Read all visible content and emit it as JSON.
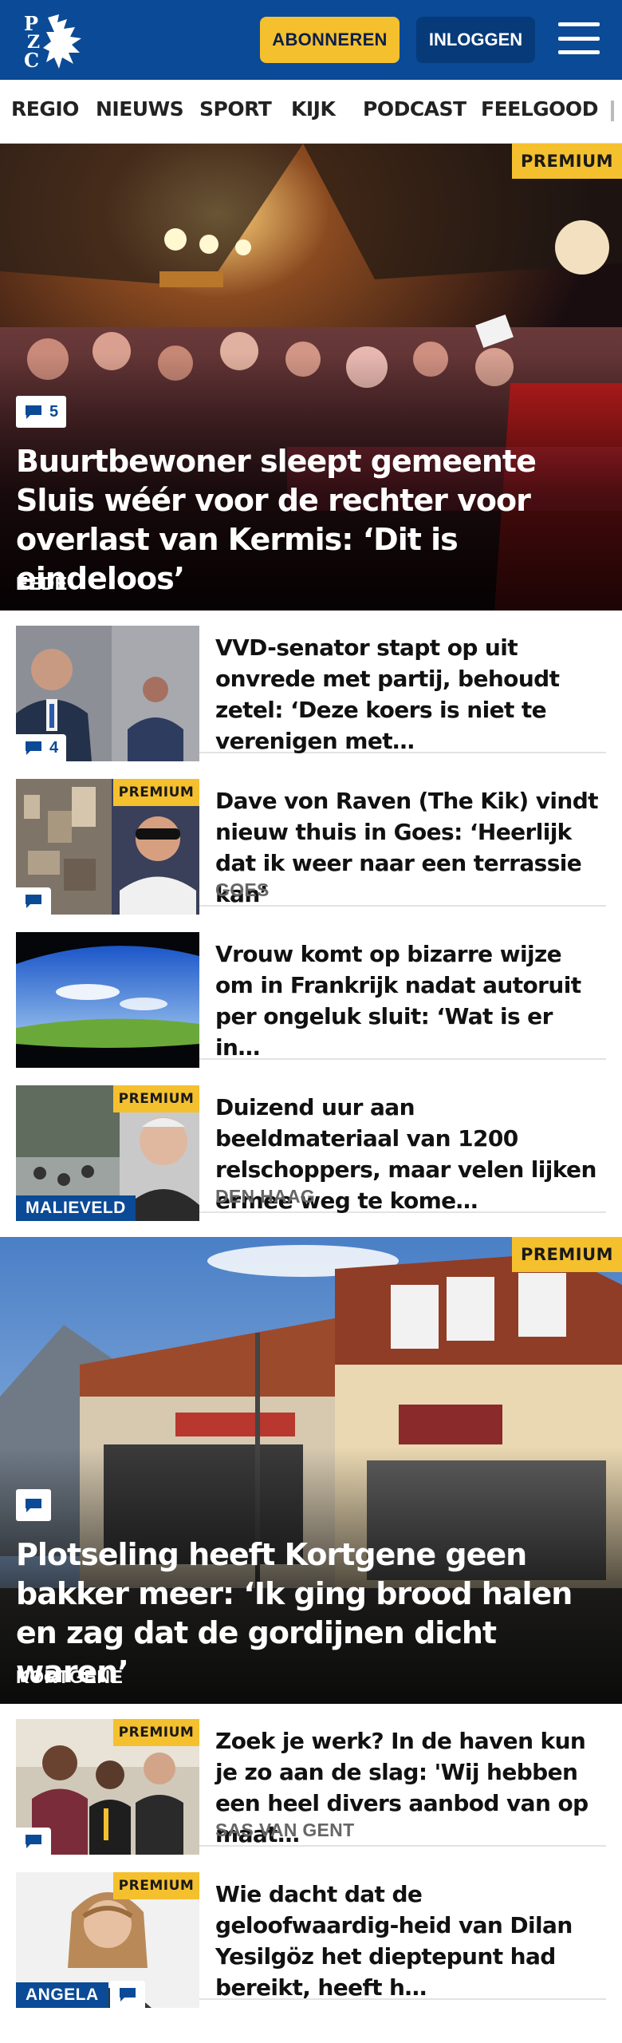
{
  "header": {
    "logo_text": "PZC",
    "subscribe_label": "ABONNEREN",
    "login_label": "INLOGGEN"
  },
  "nav": {
    "items": [
      "REGIO",
      "NIEUWS",
      "SPORT",
      "KIJK",
      "PODCAST",
      "FEELGOOD"
    ]
  },
  "hero1": {
    "badge": "PREMIUM",
    "comments": "5",
    "title": "Buurtbewoner sleept gemeente Sluis wéér voor de rechter voor overlast van Kermis: ‘Dit is eindeloos’",
    "location": "EEDE"
  },
  "items1": [
    {
      "title": "VVD-senator stapt op uit onvrede met partij, behoudt zetel: ‘Deze koers is niet te verenigen met…",
      "comments": "4",
      "location": ""
    },
    {
      "title": "Dave von Raven (The Kik) vindt nieuw thuis in Goes: ‘Heerlijk dat ik weer naar een terrassie kan’",
      "badge": "PREMIUM",
      "location": "GOES"
    },
    {
      "title": "Vrouw komt op bizarre wijze om in Frankrijk nadat autoruit per ongeluk sluit: ‘Wat is er in…",
      "location": ""
    },
    {
      "title": "Duizend uur aan beeldmateriaal van 1200 relschoppers, maar velen lijken ermee weg te kome…",
      "badge": "PREMIUM",
      "tag": "MALIEVELD",
      "location": "DEN HAAG"
    }
  ],
  "hero2": {
    "badge": "PREMIUM",
    "title": "Plotseling heeft Kortgene geen bakker meer: ‘Ik ging brood halen en zag dat de gordijnen dicht waren’",
    "location": "KORTGENE"
  },
  "items2": [
    {
      "title": "Zoek je werk? In de haven kun je zo aan de slag: 'Wij hebben een heel divers aanbod van op maat…",
      "badge": "PREMIUM",
      "location": "SAS VAN GENT"
    },
    {
      "title": "Wie dacht dat de geloofwaardig-heid van Dilan Yesilgöz het dieptepunt had bereikt, heeft h…",
      "badge": "PREMIUM",
      "tag": "ANGELA",
      "location": ""
    }
  ],
  "colors": {
    "brand_blue": "#0b4a96",
    "premium_yellow": "#f5c02e"
  }
}
